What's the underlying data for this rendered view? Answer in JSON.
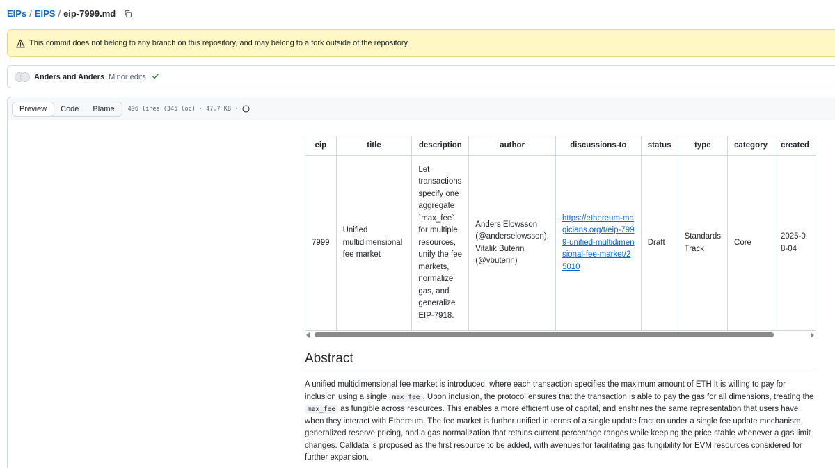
{
  "breadcrumb": {
    "root": "EIPs",
    "folder": "EIPS",
    "file": "eip-7999.md"
  },
  "flash": {
    "message": "This commit does not belong to any branch on this repository, and may belong to a fork outside of the repository."
  },
  "commit": {
    "authors": "Anders and Anders",
    "message": "Minor edits"
  },
  "filebar": {
    "tabs": [
      "Preview",
      "Code",
      "Blame"
    ],
    "info": "496 lines (345 loc) · 47.7 KB ·"
  },
  "table": {
    "headers": [
      "eip",
      "title",
      "description",
      "author",
      "discussions-to",
      "status",
      "type",
      "category",
      "created"
    ],
    "row": {
      "eip": "7999",
      "title": "Unified multidimensional fee market",
      "description": "Let transactions specify one aggregate `max_fee` for multiple resources, unify the fee markets, normalize gas, and generalize EIP-7918.",
      "author": "Anders Elowsson (@anderselowsson), Vitalik Buterin (@vbuterin)",
      "discussions_to": "https://ethereum-magicians.org/t/eip-7999-unified-multidimensional-fee-market/25010",
      "status": "Draft",
      "type": "Standards Track",
      "category": "Core",
      "created": "2025-08-04"
    }
  },
  "abstract": {
    "heading": "Abstract",
    "p1": "A unified multidimensional fee market is introduced, where each transaction specifies the maximum amount of ETH it is willing to pay for inclusion using a single ",
    "code1": "max_fee",
    "p2": ". Upon inclusion, the protocol ensures that the transaction is able to pay the gas for all dimensions, treating the ",
    "code2": "max_fee",
    "p3": " as fungible across resources. This enables a more efficient use of capital, and enshrines the same representation that users have when they interact with Ethereum. The fee market is further unified in terms of a single update fraction under a single fee update mechanism, generalized reserve pricing, and a gas normalization that retains current percentage ranges while keeping the price stable whenever a gas limit changes. Calldata is proposed as the first resource to be added, with avenues for facilitating gas fungibility for EVM resources considered for further expansion."
  }
}
